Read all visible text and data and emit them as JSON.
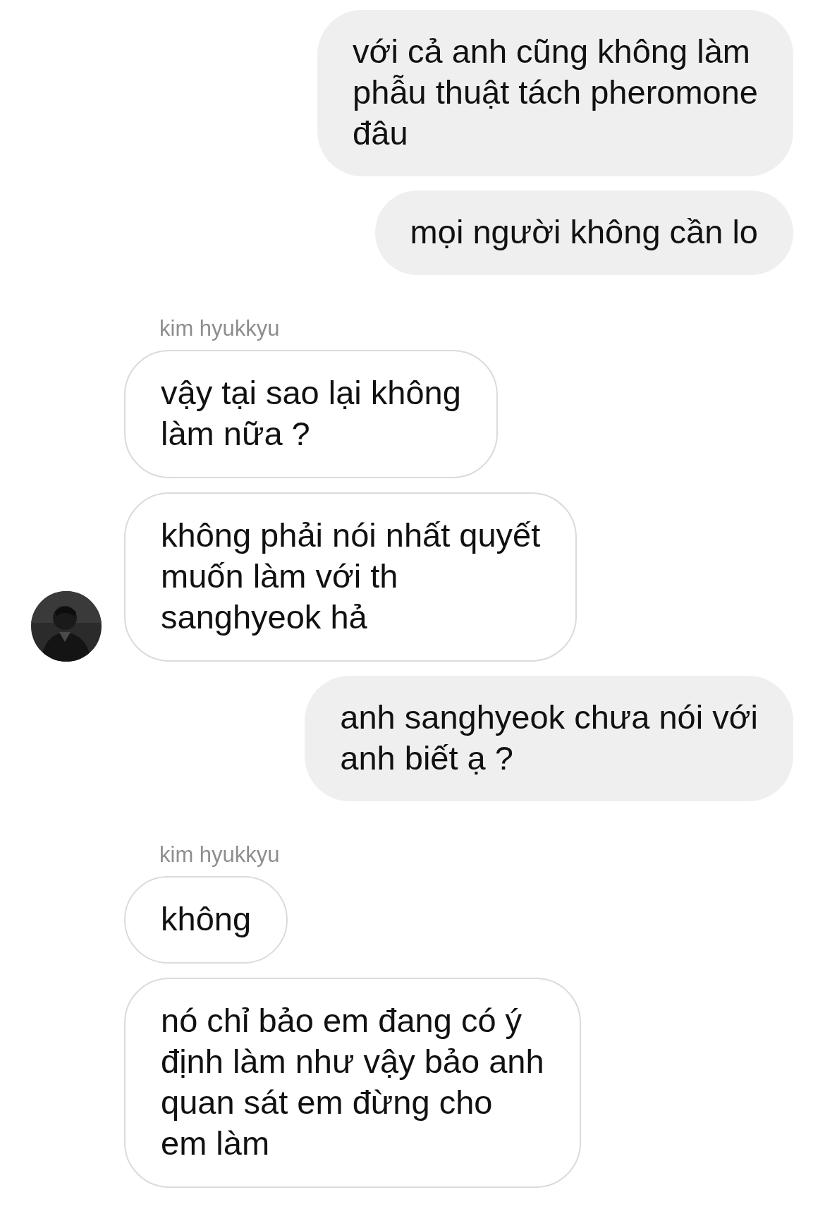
{
  "messages": [
    {
      "kind": "sent",
      "text": "với cả anh cũng không làm\nphẫu thuật tách pheromone\nđâu"
    },
    {
      "kind": "sent",
      "text": "mọi người không cần lo"
    },
    {
      "kind": "name",
      "text": "kim hyukkyu"
    },
    {
      "kind": "received",
      "text": "vậy tại sao lại không\nlàm nữa ?",
      "avatar": false
    },
    {
      "kind": "received",
      "text": "không phải nói nhất quyết\nmuốn làm với th\nsanghyeok hả",
      "avatar": true
    },
    {
      "kind": "sent",
      "text": "anh sanghyeok chưa nói với\nanh biết ạ ?"
    },
    {
      "kind": "name",
      "text": "kim hyukkyu"
    },
    {
      "kind": "received",
      "text": "không",
      "avatar": false
    },
    {
      "kind": "received",
      "text": "nó chỉ bảo em đang có ý\nđịnh làm như vậy bảo anh\nquan sát em đừng cho\nem làm",
      "avatar": false
    }
  ]
}
